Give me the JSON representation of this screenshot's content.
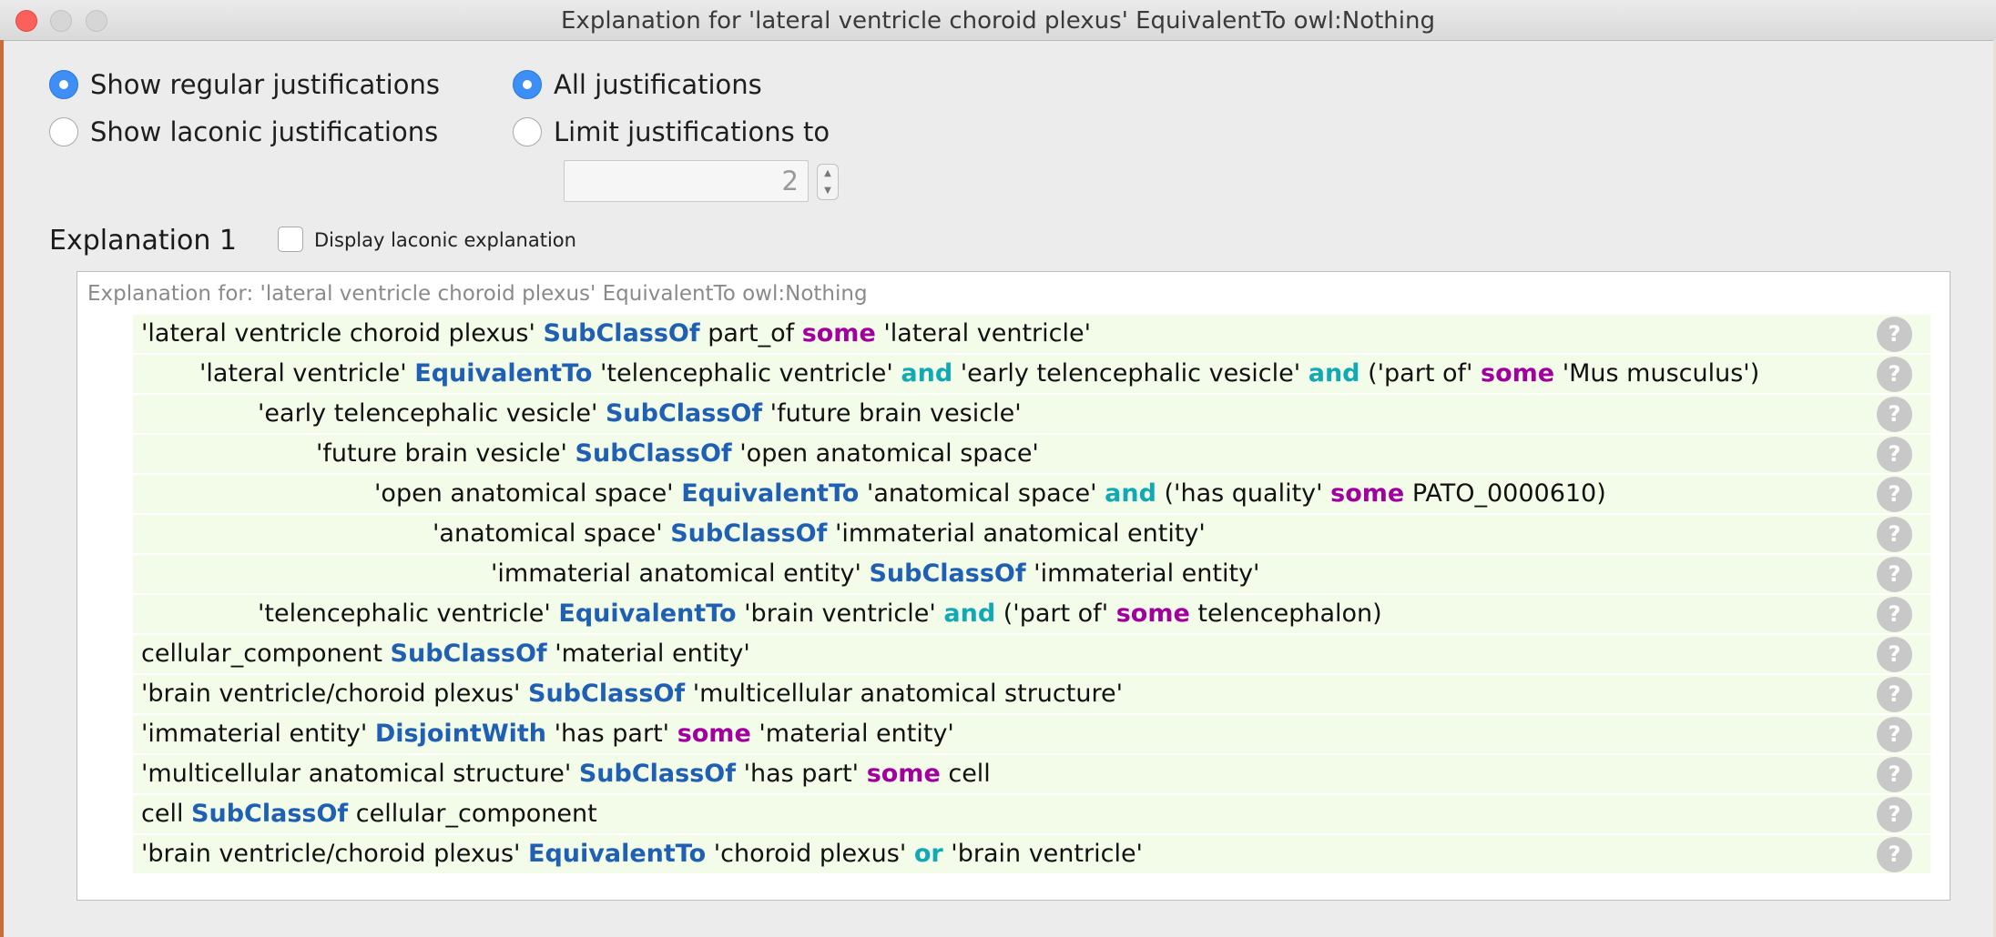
{
  "window": {
    "title": "Explanation for 'lateral ventricle choroid plexus' EquivalentTo owl:Nothing"
  },
  "options": {
    "show_regular": "Show regular justifications",
    "show_laconic": "Show laconic justifications",
    "all_justifications": "All justifications",
    "limit_justifications": "Limit justifications to",
    "limit_value": "2",
    "selected_mode": "regular",
    "selected_limit": "all"
  },
  "explanation": {
    "section_title": "Explanation 1",
    "display_laconic_label": "Display laconic explanation",
    "display_laconic_checked": false,
    "header": "Explanation for: 'lateral ventricle choroid plexus' EquivalentTo owl:Nothing",
    "help_symbol": "?",
    "rows": [
      {
        "indent": 0,
        "parts": [
          {
            "t": "'lateral ventricle choroid plexus' "
          },
          {
            "t": "SubClassOf",
            "k": "blue"
          },
          {
            "t": " part_of "
          },
          {
            "t": "some",
            "k": "purple"
          },
          {
            "t": " 'lateral ventricle'"
          }
        ]
      },
      {
        "indent": 1,
        "parts": [
          {
            "t": "'lateral ventricle' "
          },
          {
            "t": "EquivalentTo",
            "k": "blue"
          },
          {
            "t": " 'telencephalic ventricle' "
          },
          {
            "t": "and",
            "k": "teal"
          },
          {
            "t": " 'early telencephalic vesicle' "
          },
          {
            "t": "and",
            "k": "teal"
          },
          {
            "t": " ('part of' "
          },
          {
            "t": "some",
            "k": "purple"
          },
          {
            "t": " 'Mus musculus')"
          }
        ]
      },
      {
        "indent": 2,
        "parts": [
          {
            "t": "'early telencephalic vesicle' "
          },
          {
            "t": "SubClassOf",
            "k": "blue"
          },
          {
            "t": " 'future brain vesicle'"
          }
        ]
      },
      {
        "indent": 3,
        "parts": [
          {
            "t": "'future brain vesicle' "
          },
          {
            "t": "SubClassOf",
            "k": "blue"
          },
          {
            "t": " 'open anatomical space'"
          }
        ]
      },
      {
        "indent": 4,
        "parts": [
          {
            "t": "'open anatomical space' "
          },
          {
            "t": "EquivalentTo",
            "k": "blue"
          },
          {
            "t": " 'anatomical space' "
          },
          {
            "t": "and",
            "k": "teal"
          },
          {
            "t": " ('has quality' "
          },
          {
            "t": "some",
            "k": "purple"
          },
          {
            "t": " PATO_0000610)"
          }
        ]
      },
      {
        "indent": 5,
        "parts": [
          {
            "t": "'anatomical space' "
          },
          {
            "t": "SubClassOf",
            "k": "blue"
          },
          {
            "t": " 'immaterial anatomical entity'"
          }
        ]
      },
      {
        "indent": 6,
        "parts": [
          {
            "t": "'immaterial anatomical entity' "
          },
          {
            "t": "SubClassOf",
            "k": "blue"
          },
          {
            "t": " 'immaterial entity'"
          }
        ]
      },
      {
        "indent": 2,
        "parts": [
          {
            "t": "'telencephalic ventricle' "
          },
          {
            "t": "EquivalentTo",
            "k": "blue"
          },
          {
            "t": " 'brain ventricle' "
          },
          {
            "t": "and",
            "k": "teal"
          },
          {
            "t": " ('part of' "
          },
          {
            "t": "some",
            "k": "purple"
          },
          {
            "t": " telencephalon)"
          }
        ]
      },
      {
        "indent": 0,
        "parts": [
          {
            "t": "cellular_component "
          },
          {
            "t": "SubClassOf",
            "k": "blue"
          },
          {
            "t": " 'material entity'"
          }
        ]
      },
      {
        "indent": 0,
        "parts": [
          {
            "t": "'brain ventricle/choroid plexus' "
          },
          {
            "t": "SubClassOf",
            "k": "blue"
          },
          {
            "t": " 'multicellular anatomical structure'"
          }
        ]
      },
      {
        "indent": 0,
        "parts": [
          {
            "t": "'immaterial entity' "
          },
          {
            "t": "DisjointWith",
            "k": "blue"
          },
          {
            "t": " 'has part' "
          },
          {
            "t": "some",
            "k": "purple"
          },
          {
            "t": " 'material entity'"
          }
        ]
      },
      {
        "indent": 0,
        "parts": [
          {
            "t": "'multicellular anatomical structure' "
          },
          {
            "t": "SubClassOf",
            "k": "blue"
          },
          {
            "t": " 'has part' "
          },
          {
            "t": "some",
            "k": "purple"
          },
          {
            "t": " cell"
          }
        ]
      },
      {
        "indent": 0,
        "parts": [
          {
            "t": "cell "
          },
          {
            "t": "SubClassOf",
            "k": "blue"
          },
          {
            "t": " cellular_component"
          }
        ]
      },
      {
        "indent": 0,
        "parts": [
          {
            "t": "'brain ventricle/choroid plexus' "
          },
          {
            "t": "EquivalentTo",
            "k": "blue"
          },
          {
            "t": " 'choroid plexus' "
          },
          {
            "t": "or",
            "k": "teal"
          },
          {
            "t": " 'brain ventricle'"
          }
        ]
      }
    ]
  }
}
